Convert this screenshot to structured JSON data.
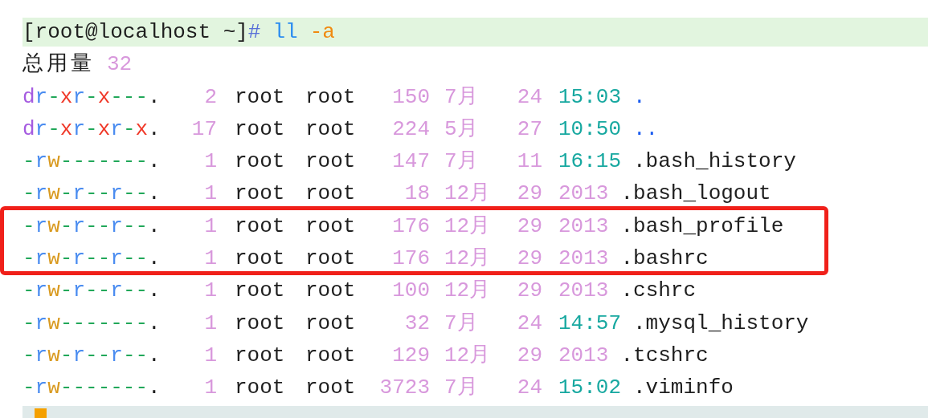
{
  "lines": [
    {
      "kind": "prompt",
      "prompt": "[root@localhost ~]",
      "sign": "#",
      "command": "ll",
      "option": "-a",
      "highlighted": true,
      "cursor": false
    },
    {
      "kind": "total",
      "label": "总用量",
      "value": "32"
    },
    {
      "kind": "entry",
      "perms": [
        {
          "text": "d",
          "kind": "type"
        },
        {
          "text": "r",
          "kind": "read"
        },
        {
          "text": "-",
          "kind": "none"
        },
        {
          "text": "x",
          "kind": "exec"
        },
        {
          "text": "r",
          "kind": "read"
        },
        {
          "text": "-",
          "kind": "none"
        },
        {
          "text": "x",
          "kind": "exec"
        },
        {
          "text": "---",
          "kind": "none"
        },
        {
          "text": ".",
          "kind": "dot"
        }
      ],
      "links": "2",
      "owner": "root",
      "group": "root",
      "size": "150",
      "month": "7月",
      "day": "24",
      "time": {
        "text": "15:03",
        "kind": "clock"
      },
      "name": {
        "text": ".",
        "kind": "dir"
      },
      "marked": false
    },
    {
      "kind": "entry",
      "perms": [
        {
          "text": "d",
          "kind": "type"
        },
        {
          "text": "r",
          "kind": "read"
        },
        {
          "text": "-",
          "kind": "none"
        },
        {
          "text": "x",
          "kind": "exec"
        },
        {
          "text": "r",
          "kind": "read"
        },
        {
          "text": "-",
          "kind": "none"
        },
        {
          "text": "x",
          "kind": "exec"
        },
        {
          "text": "r",
          "kind": "read"
        },
        {
          "text": "-",
          "kind": "none"
        },
        {
          "text": "x",
          "kind": "exec"
        },
        {
          "text": ".",
          "kind": "dot"
        }
      ],
      "links": "17",
      "owner": "root",
      "group": "root",
      "size": "224",
      "month": "5月",
      "day": "27",
      "time": {
        "text": "10:50",
        "kind": "clock"
      },
      "name": {
        "text": "..",
        "kind": "dir"
      },
      "marked": false
    },
    {
      "kind": "entry",
      "perms": [
        {
          "text": "-",
          "kind": "none"
        },
        {
          "text": "r",
          "kind": "read"
        },
        {
          "text": "w",
          "kind": "write"
        },
        {
          "text": "-------",
          "kind": "none"
        },
        {
          "text": ".",
          "kind": "dot"
        }
      ],
      "links": "1",
      "owner": "root",
      "group": "root",
      "size": "147",
      "month": "7月",
      "day": "11",
      "time": {
        "text": "16:15",
        "kind": "clock"
      },
      "name": {
        "text": ".bash_history",
        "kind": "file"
      },
      "marked": false
    },
    {
      "kind": "entry",
      "perms": [
        {
          "text": "-",
          "kind": "none"
        },
        {
          "text": "r",
          "kind": "read"
        },
        {
          "text": "w",
          "kind": "write"
        },
        {
          "text": "-",
          "kind": "none"
        },
        {
          "text": "r",
          "kind": "read"
        },
        {
          "text": "--",
          "kind": "none"
        },
        {
          "text": "r",
          "kind": "read"
        },
        {
          "text": "--",
          "kind": "none"
        },
        {
          "text": ".",
          "kind": "dot"
        }
      ],
      "links": "1",
      "owner": "root",
      "group": "root",
      "size": "18",
      "month": "12月",
      "day": "29",
      "time": {
        "text": "2013",
        "kind": "year"
      },
      "name": {
        "text": ".bash_logout",
        "kind": "file"
      },
      "marked": false
    },
    {
      "kind": "entry",
      "perms": [
        {
          "text": "-",
          "kind": "none"
        },
        {
          "text": "r",
          "kind": "read"
        },
        {
          "text": "w",
          "kind": "write"
        },
        {
          "text": "-",
          "kind": "none"
        },
        {
          "text": "r",
          "kind": "read"
        },
        {
          "text": "--",
          "kind": "none"
        },
        {
          "text": "r",
          "kind": "read"
        },
        {
          "text": "--",
          "kind": "none"
        },
        {
          "text": ".",
          "kind": "dot"
        }
      ],
      "links": "1",
      "owner": "root",
      "group": "root",
      "size": "176",
      "month": "12月",
      "day": "29",
      "time": {
        "text": "2013",
        "kind": "year"
      },
      "name": {
        "text": ".bash_profile",
        "kind": "file"
      },
      "marked": true
    },
    {
      "kind": "entry",
      "perms": [
        {
          "text": "-",
          "kind": "none"
        },
        {
          "text": "r",
          "kind": "read"
        },
        {
          "text": "w",
          "kind": "write"
        },
        {
          "text": "-",
          "kind": "none"
        },
        {
          "text": "r",
          "kind": "read"
        },
        {
          "text": "--",
          "kind": "none"
        },
        {
          "text": "r",
          "kind": "read"
        },
        {
          "text": "--",
          "kind": "none"
        },
        {
          "text": ".",
          "kind": "dot"
        }
      ],
      "links": "1",
      "owner": "root",
      "group": "root",
      "size": "176",
      "month": "12月",
      "day": "29",
      "time": {
        "text": "2013",
        "kind": "year"
      },
      "name": {
        "text": ".bashrc",
        "kind": "file"
      },
      "marked": true
    },
    {
      "kind": "entry",
      "perms": [
        {
          "text": "-",
          "kind": "none"
        },
        {
          "text": "r",
          "kind": "read"
        },
        {
          "text": "w",
          "kind": "write"
        },
        {
          "text": "-",
          "kind": "none"
        },
        {
          "text": "r",
          "kind": "read"
        },
        {
          "text": "--",
          "kind": "none"
        },
        {
          "text": "r",
          "kind": "read"
        },
        {
          "text": "--",
          "kind": "none"
        },
        {
          "text": ".",
          "kind": "dot"
        }
      ],
      "links": "1",
      "owner": "root",
      "group": "root",
      "size": "100",
      "month": "12月",
      "day": "29",
      "time": {
        "text": "2013",
        "kind": "year"
      },
      "name": {
        "text": ".cshrc",
        "kind": "file"
      },
      "marked": false
    },
    {
      "kind": "entry",
      "perms": [
        {
          "text": "-",
          "kind": "none"
        },
        {
          "text": "r",
          "kind": "read"
        },
        {
          "text": "w",
          "kind": "write"
        },
        {
          "text": "-------",
          "kind": "none"
        },
        {
          "text": ".",
          "kind": "dot"
        }
      ],
      "links": "1",
      "owner": "root",
      "group": "root",
      "size": "32",
      "month": "7月",
      "day": "24",
      "time": {
        "text": "14:57",
        "kind": "clock"
      },
      "name": {
        "text": ".mysql_history",
        "kind": "file"
      },
      "marked": false
    },
    {
      "kind": "entry",
      "perms": [
        {
          "text": "-",
          "kind": "none"
        },
        {
          "text": "r",
          "kind": "read"
        },
        {
          "text": "w",
          "kind": "write"
        },
        {
          "text": "-",
          "kind": "none"
        },
        {
          "text": "r",
          "kind": "read"
        },
        {
          "text": "--",
          "kind": "none"
        },
        {
          "text": "r",
          "kind": "read"
        },
        {
          "text": "--",
          "kind": "none"
        },
        {
          "text": ".",
          "kind": "dot"
        }
      ],
      "links": "1",
      "owner": "root",
      "group": "root",
      "size": "129",
      "month": "12月",
      "day": "29",
      "time": {
        "text": "2013",
        "kind": "year"
      },
      "name": {
        "text": ".tcshrc",
        "kind": "file"
      },
      "marked": false
    },
    {
      "kind": "entry",
      "perms": [
        {
          "text": "-",
          "kind": "none"
        },
        {
          "text": "r",
          "kind": "read"
        },
        {
          "text": "w",
          "kind": "write"
        },
        {
          "text": "-------",
          "kind": "none"
        },
        {
          "text": ".",
          "kind": "dot"
        }
      ],
      "links": "1",
      "owner": "root",
      "group": "root",
      "size": "3723",
      "month": "7月",
      "day": "24",
      "time": {
        "text": "15:02",
        "kind": "clock"
      },
      "name": {
        "text": ".viminfo",
        "kind": "file"
      },
      "marked": false
    },
    {
      "kind": "prompt",
      "highlighted": false,
      "cursor": true
    }
  ]
}
